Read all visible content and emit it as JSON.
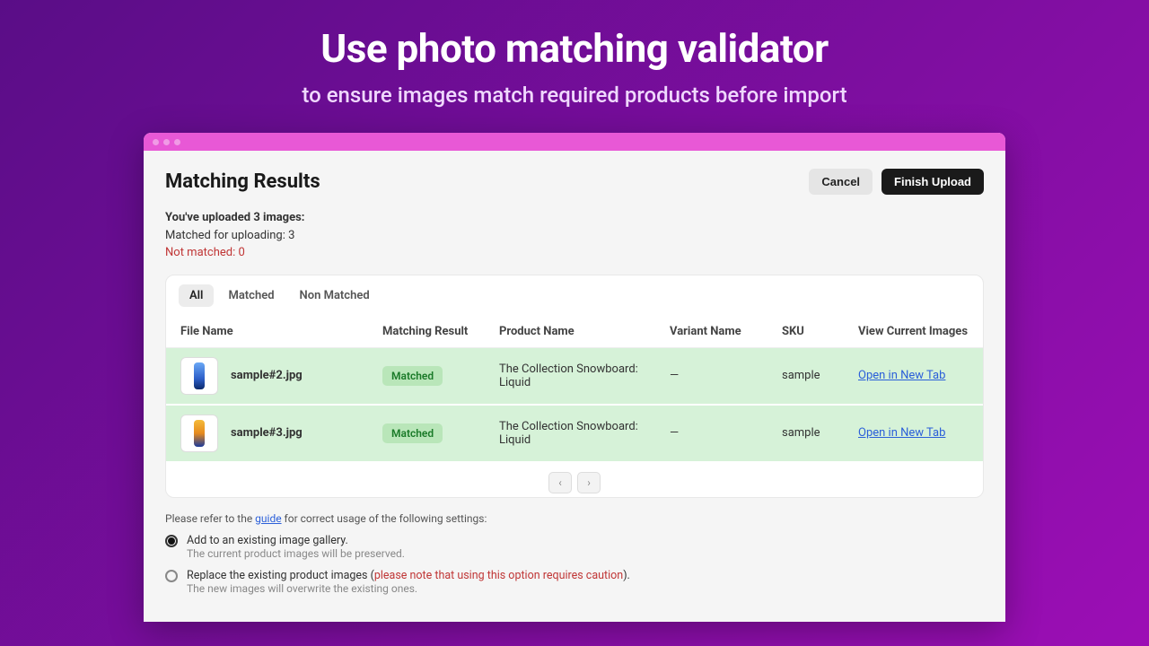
{
  "hero": {
    "title": "Use photo matching validator",
    "subtitle": "to ensure images match required products before import"
  },
  "page": {
    "title": "Matching Results",
    "cancel": "Cancel",
    "finish": "Finish Upload"
  },
  "summary": {
    "uploaded": "You've uploaded 3 images:",
    "matched": "Matched for uploading: 3",
    "notmatched": "Not matched: 0"
  },
  "tabs": {
    "all": "All",
    "matched": "Matched",
    "non": "Non Matched"
  },
  "columns": {
    "file": "File Name",
    "result": "Matching Result",
    "product": "Product Name",
    "variant": "Variant Name",
    "sku": "SKU",
    "view": "View Current Images"
  },
  "rows": [
    {
      "file": "sample#2.jpg",
      "badge": "Matched",
      "product": "The Collection Snowboard: Liquid",
      "variant": "—",
      "sku": "sample",
      "link": "Open in New Tab"
    },
    {
      "file": "sample#3.jpg",
      "badge": "Matched",
      "product": "The Collection Snowboard: Liquid",
      "variant": "—",
      "sku": "sample",
      "link": "Open in New Tab"
    }
  ],
  "note": {
    "pre": "Please refer to the ",
    "guide": "guide",
    "post": " for correct usage of the following settings:"
  },
  "options": {
    "add": {
      "label": "Add to an existing image gallery.",
      "sub": "The current product images will be preserved."
    },
    "replace": {
      "pre": "Replace the existing product images (",
      "caution": "please note that using this option requires caution",
      "post": ").",
      "sub": "The new images will overwrite the existing ones."
    }
  }
}
